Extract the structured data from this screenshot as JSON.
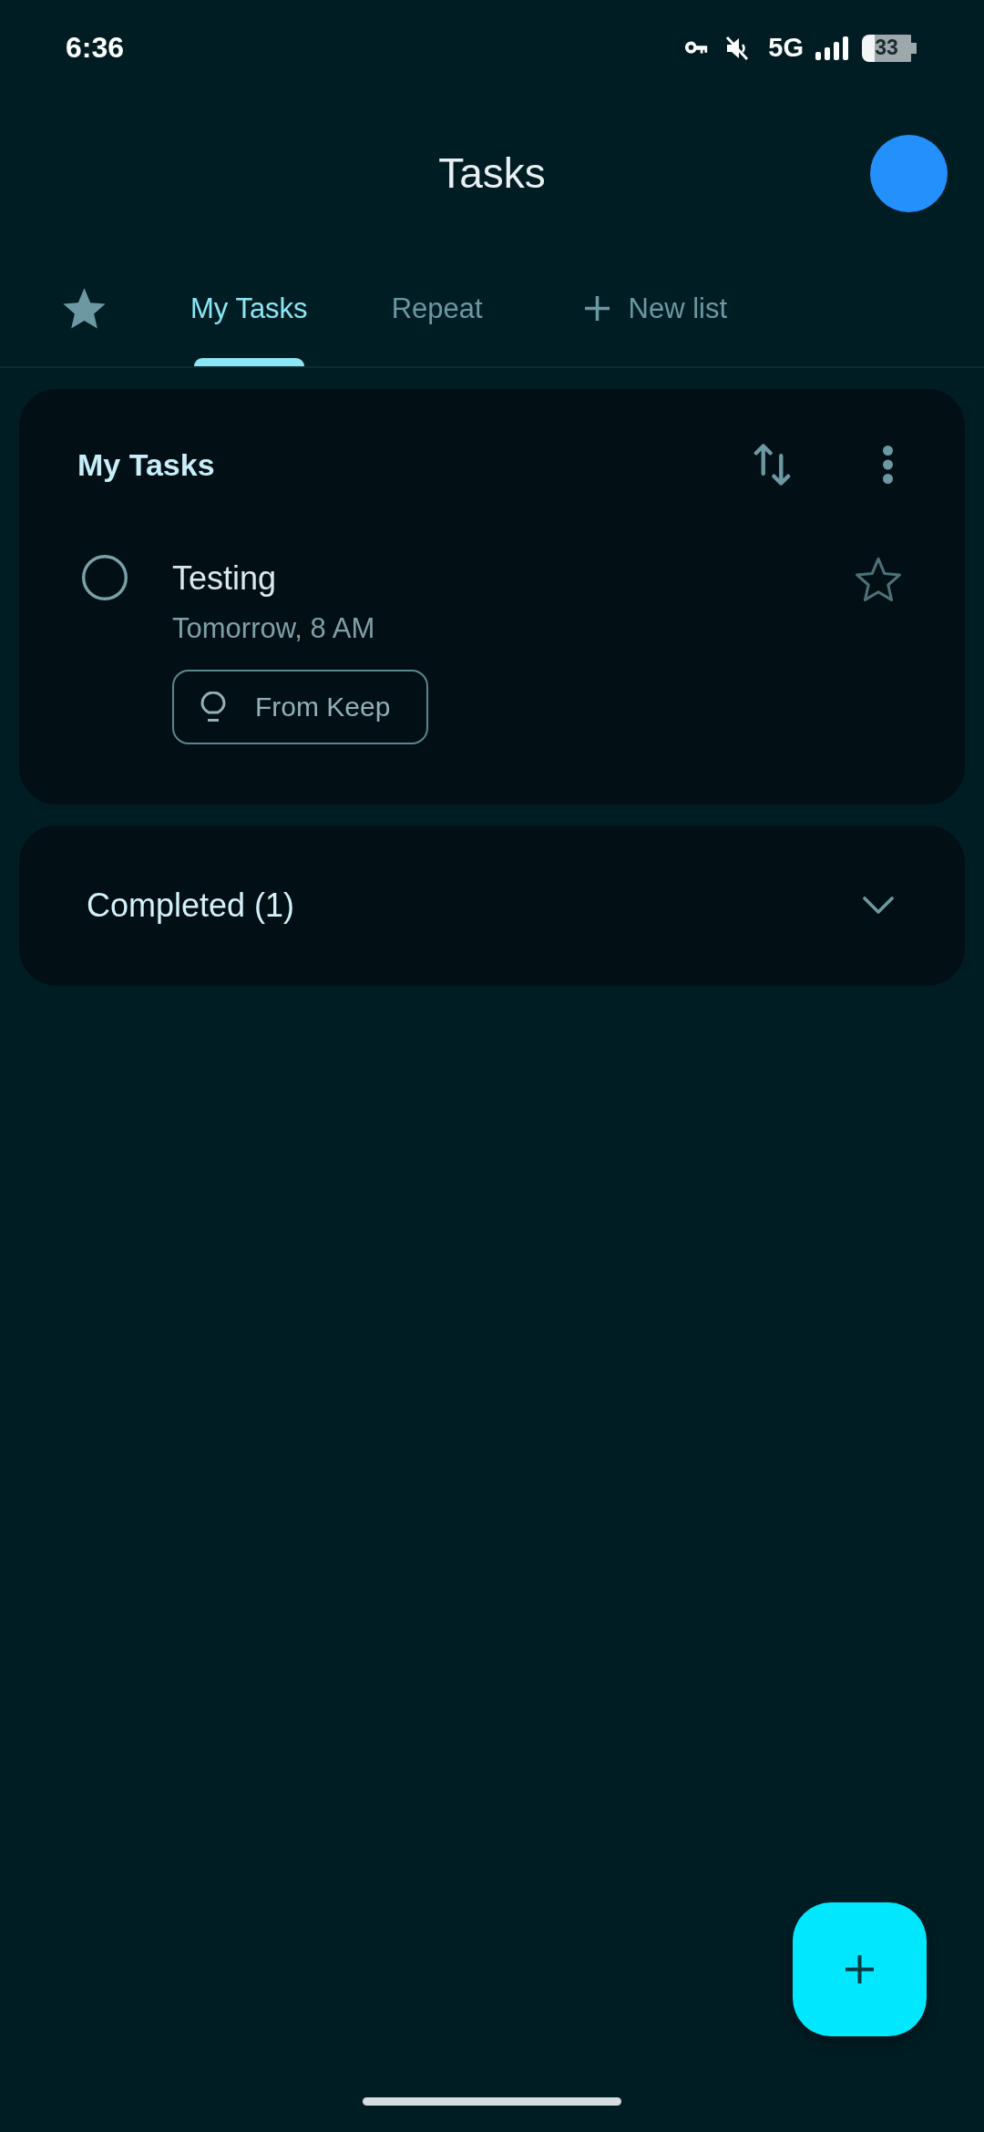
{
  "status_bar": {
    "time": "6:36",
    "network": "5G",
    "battery": "33"
  },
  "header": {
    "title": "Tasks"
  },
  "tabs": [
    {
      "kind": "starred",
      "selected": false
    },
    {
      "kind": "list",
      "label": "My Tasks",
      "selected": true
    },
    {
      "kind": "list",
      "label": "Repeat",
      "selected": false
    }
  ],
  "new_list": {
    "label": "New list"
  },
  "list_card": {
    "title": "My Tasks",
    "tasks": [
      {
        "title": "Testing",
        "due": "Tomorrow, 8 AM",
        "chip": "From Keep",
        "completed": false,
        "starred": false
      }
    ]
  },
  "completed_section": {
    "label": "Completed (1)",
    "expanded": false
  }
}
